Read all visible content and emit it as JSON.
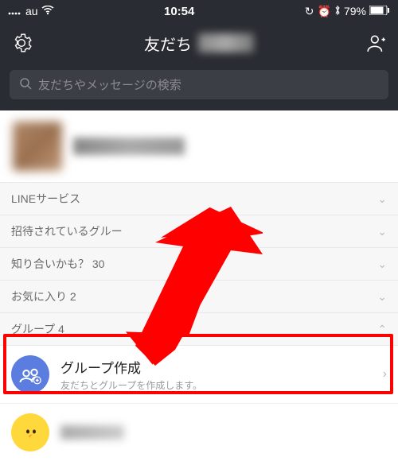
{
  "status": {
    "carrier": "au",
    "time": "10:54",
    "battery": "79%"
  },
  "header": {
    "title": "友だち"
  },
  "search": {
    "placeholder": "友だちやメッセージの検索"
  },
  "sections": [
    {
      "label": "LINEサービス",
      "expand": "down"
    },
    {
      "label": "招待されているグルー",
      "expand": "down"
    },
    {
      "label": "知り合いかも？ 30",
      "expand": "down"
    },
    {
      "label": "お気に入り 2",
      "expand": "down"
    },
    {
      "label": "グループ 4",
      "expand": "up"
    }
  ],
  "group_create": {
    "title": "グループ作成",
    "subtitle": "友だちとグループを作成します。"
  },
  "colors": {
    "header_bg": "#2a2c33",
    "accent": "#5b7de0",
    "highlight": "#ff0000",
    "sally": "#ffd93b"
  }
}
